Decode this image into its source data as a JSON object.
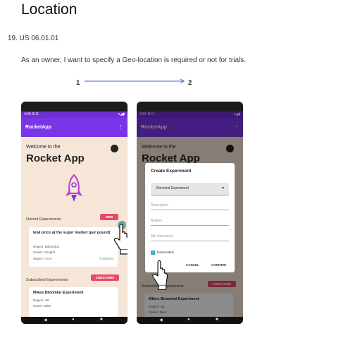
{
  "title": "Location",
  "item": "19. US 06.01.01",
  "story": "As an owner, I want to specify a Geo-location is required or not for trials.",
  "steps": {
    "from": "1",
    "to": "2"
  },
  "phone1": {
    "status_time": "4:59",
    "status_icons": "B G ·",
    "status_right": "▾◢▮",
    "app_title": "RocketApp",
    "menu": "⋮",
    "welcome": "Welcome to the",
    "app_name": "Rocket App",
    "owned_label": "Owned Experiments",
    "new_label": "NEW",
    "card1": {
      "title": "kiwi price at the super market (per pound)",
      "region": "Region: Edmonton",
      "owner": "Owner: zsingh2",
      "status_label": "Status: ",
      "status_value": "Active",
      "published": "Published"
    },
    "subscribed_label": "Subscribed Experiments",
    "subscribe_label": "SUBSCRIBE",
    "card2": {
      "title": "Mikes Binomial Experiment",
      "region": "Region: AB",
      "owner": "Owner: Mike"
    }
  },
  "phone2": {
    "status_time": "4:59",
    "status_icons": "B G ·",
    "status_right": "▾◢▮",
    "app_title": "RocketApp",
    "menu": "⋮",
    "welcome": "Welcome to the",
    "app_name": "Rocket App",
    "subscribed_label": "Subscribed Experiments",
    "subscribe_label": "SUBSCRIBE",
    "card2_title": "Mikes Binomial Experiment",
    "card2_region": "Region: AB",
    "card2_owner": "Owner: Mike",
    "dialog": {
      "title": "Create Experiment",
      "dropdown_value": "Binomial Experiment",
      "description_placeholder": "Description",
      "region_placeholder": "Region",
      "min_trial_placeholder": "Min trial count",
      "geolocation_label": "Geolocation",
      "cancel": "CANCEL",
      "confirm": "CONFIRM"
    }
  },
  "colors": {
    "primary": "#7b35e8",
    "accent": "#e54a6a",
    "background": "#f5e6d8",
    "checkbox": "#2ba8c4"
  }
}
